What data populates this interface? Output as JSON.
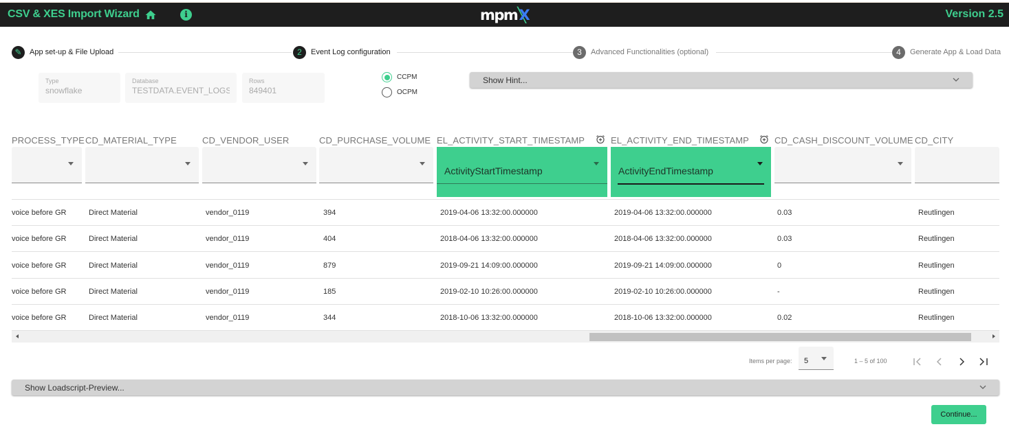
{
  "header": {
    "title": "CSV & XES Import Wizard",
    "home_icon": "home-icon",
    "info_icon": "info-icon",
    "info_glyph": "i",
    "logo": {
      "main": "mpm",
      "x_green": "╲",
      "x_blue": "X"
    },
    "version": "Version 2.5"
  },
  "colors": {
    "accent": "#3ecf8e",
    "topbar": "#1e1e1e",
    "logo_blue": "#3a7bf2"
  },
  "stepper": {
    "steps": [
      {
        "number": "✎",
        "label": "App set-up & File Upload",
        "state": "done"
      },
      {
        "number": "2",
        "label": "Event Log configuration",
        "state": "active"
      },
      {
        "number": "3",
        "label": "Advanced Functionalities (optional)",
        "state": "inactive"
      },
      {
        "number": "4",
        "label": "Generate App & Load Data",
        "state": "inactive"
      }
    ]
  },
  "source_info": {
    "type": {
      "label": "Type",
      "value": "snowflake"
    },
    "database": {
      "label": "Database",
      "value": "TESTDATA.EVENT_LOGS."
    },
    "rows": {
      "label": "Rows",
      "value": "849401"
    }
  },
  "mode": {
    "options": [
      {
        "label": "CCPM",
        "checked": true
      },
      {
        "label": "OCPM",
        "checked": false
      }
    ]
  },
  "hint": {
    "label": "Show Hint..."
  },
  "table": {
    "columns": [
      {
        "header": "PROCESS_TYPE",
        "mapping": "",
        "highlighted": false,
        "timestamp_icon": false
      },
      {
        "header": "CD_MATERIAL_TYPE",
        "mapping": "",
        "highlighted": false,
        "timestamp_icon": false
      },
      {
        "header": "CD_VENDOR_USER",
        "mapping": "",
        "highlighted": false,
        "timestamp_icon": false
      },
      {
        "header": "CD_PURCHASE_VOLUME",
        "mapping": "",
        "highlighted": false,
        "timestamp_icon": false
      },
      {
        "header": "EL_ACTIVITY_START_TIMESTAMP",
        "mapping": "ActivityStartTimestamp",
        "highlighted": true,
        "timestamp_icon": true
      },
      {
        "header": "EL_ACTIVITY_END_TIMESTAMP",
        "mapping": "ActivityEndTimestamp",
        "highlighted": true,
        "timestamp_icon": true
      },
      {
        "header": "CD_CASH_DISCOUNT_VOLUME",
        "mapping": "",
        "highlighted": false,
        "timestamp_icon": false
      },
      {
        "header": "CD_CITY",
        "mapping": "",
        "highlighted": false,
        "timestamp_icon": false
      }
    ],
    "rows": [
      [
        "voice before GR",
        "Direct Material",
        "vendor_0119",
        "394",
        "2019-04-06 13:32:00.000000",
        "2019-04-06 13:32:00.000000",
        "0.03",
        "Reutlingen"
      ],
      [
        "voice before GR",
        "Direct Material",
        "vendor_0119",
        "404",
        "2018-04-06 13:32:00.000000",
        "2018-04-06 13:32:00.000000",
        "0.03",
        "Reutlingen"
      ],
      [
        "voice before GR",
        "Direct Material",
        "vendor_0119",
        "879",
        "2019-09-21 14:09:00.000000",
        "2019-09-21 14:09:00.000000",
        "0",
        "Reutlingen"
      ],
      [
        "voice before GR",
        "Direct Material",
        "vendor_0119",
        "185",
        "2019-02-10 10:26:00.000000",
        "2019-02-10 10:26:00.000000",
        "-",
        "Reutlingen"
      ],
      [
        "voice before GR",
        "Direct Material",
        "vendor_0119",
        "344",
        "2018-10-06 13:32:00.000000",
        "2018-10-06 13:32:00.000000",
        "0.02",
        "Reutlingen"
      ]
    ]
  },
  "paginator": {
    "items_per_page_label": "Items per page:",
    "items_per_page": "5",
    "range": "1 – 5 of 100",
    "buttons": [
      "first-page",
      "previous-page",
      "next-page",
      "last-page"
    ]
  },
  "loadscript": {
    "label": "Show Loadscript-Preview..."
  },
  "continue_label": "Continue..."
}
